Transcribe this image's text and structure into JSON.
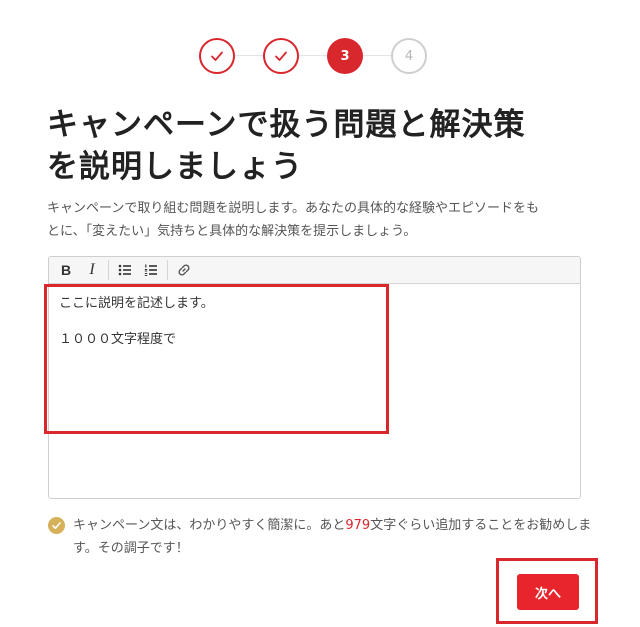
{
  "stepper": {
    "steps": [
      {
        "state": "done",
        "label": ""
      },
      {
        "state": "done",
        "label": ""
      },
      {
        "state": "active",
        "label": "3"
      },
      {
        "state": "todo",
        "label": "4"
      }
    ],
    "done_icon": "check-icon"
  },
  "title": {
    "line1": "キャンペーンで扱う問題と解決策",
    "line2": "を説明しましょう"
  },
  "description": {
    "line1": "キャンペーンで取り組む問題を説明します。あなたの具体的な経験やエピソードをも",
    "line2": "とに、「変えたい」気持ちと具体的な解決策を提示しましょう。"
  },
  "editor": {
    "toolbar": {
      "bold_label": "B",
      "italic_label": "I",
      "bullet_list_icon": "bullet-list-icon",
      "numbered_list_icon": "numbered-list-icon",
      "link_icon": "link-icon"
    },
    "content": {
      "line1": "ここに説明を記述します。",
      "line2": "１０００文字程度で"
    }
  },
  "hint": {
    "text_before": "キャンペーン文は、わかりやすく簡潔に。あと",
    "count": "979",
    "text_after": "文字ぐらい追加することをお勧めします。その調子です！",
    "icon": "check-circle-icon"
  },
  "next_button": {
    "label": "次へ"
  },
  "colors": {
    "accent": "#d9272e",
    "hint_icon": "#d6b15a",
    "inactive": "#cfcfcf"
  }
}
